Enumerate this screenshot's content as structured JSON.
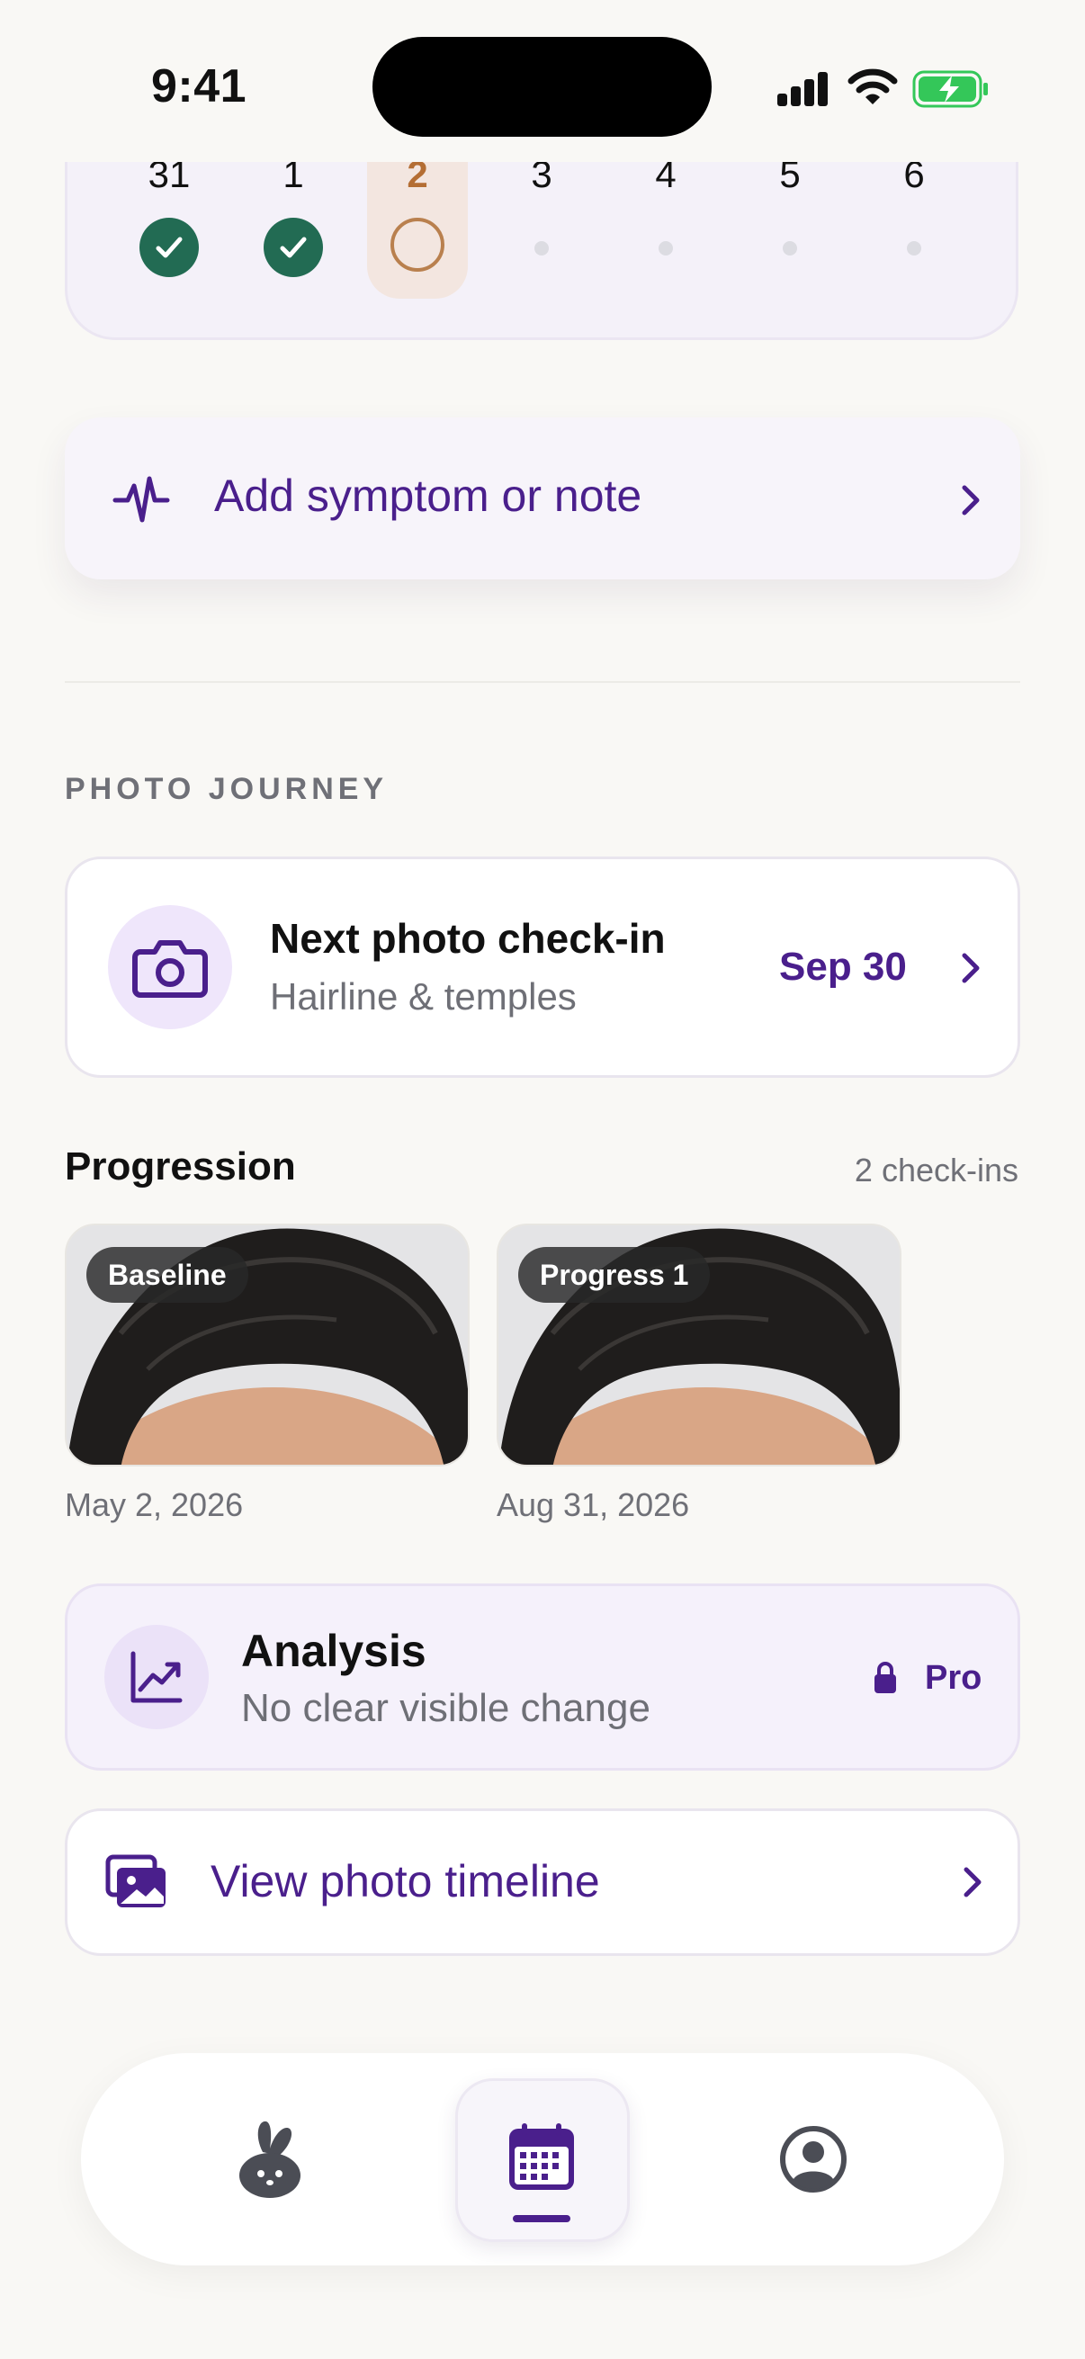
{
  "status_bar": {
    "time": "9:41"
  },
  "week": {
    "days": [
      {
        "num": "31",
        "state": "done"
      },
      {
        "num": "1",
        "state": "done"
      },
      {
        "num": "2",
        "state": "today"
      },
      {
        "num": "3",
        "state": "future"
      },
      {
        "num": "4",
        "state": "future"
      },
      {
        "num": "5",
        "state": "future"
      },
      {
        "num": "6",
        "state": "future"
      }
    ]
  },
  "symptom_card": {
    "label": "Add symptom or note",
    "icon": "pulse-icon"
  },
  "photo_journey": {
    "section_title": "PHOTO JOURNEY",
    "next_checkin": {
      "title": "Next photo check-in",
      "subtitle": "Hairline & temples",
      "date": "Sep 30",
      "icon": "camera-icon"
    },
    "progression": {
      "title": "Progression",
      "count": "2 check-ins",
      "photos": [
        {
          "badge": "Baseline",
          "date": "May 2, 2026"
        },
        {
          "badge": "Progress 1",
          "date": "Aug 31, 2026"
        }
      ]
    },
    "analysis": {
      "title": "Analysis",
      "subtitle": "No clear visible change",
      "pro_label": "Pro",
      "icon": "trend-chart-icon"
    },
    "timeline_button": {
      "label": "View photo timeline",
      "icon": "photo-stack-icon"
    }
  },
  "tabbar": {
    "tabs": [
      {
        "name": "bunny-home",
        "icon": "bunny-icon",
        "active": false
      },
      {
        "name": "calendar",
        "icon": "calendar-icon",
        "active": true
      },
      {
        "name": "profile",
        "icon": "profile-icon",
        "active": false
      }
    ]
  },
  "colors": {
    "accent": "#4a1f8c",
    "done_green": "#226b53",
    "today_orange": "#b46e34",
    "background": "#f9f8f5"
  }
}
